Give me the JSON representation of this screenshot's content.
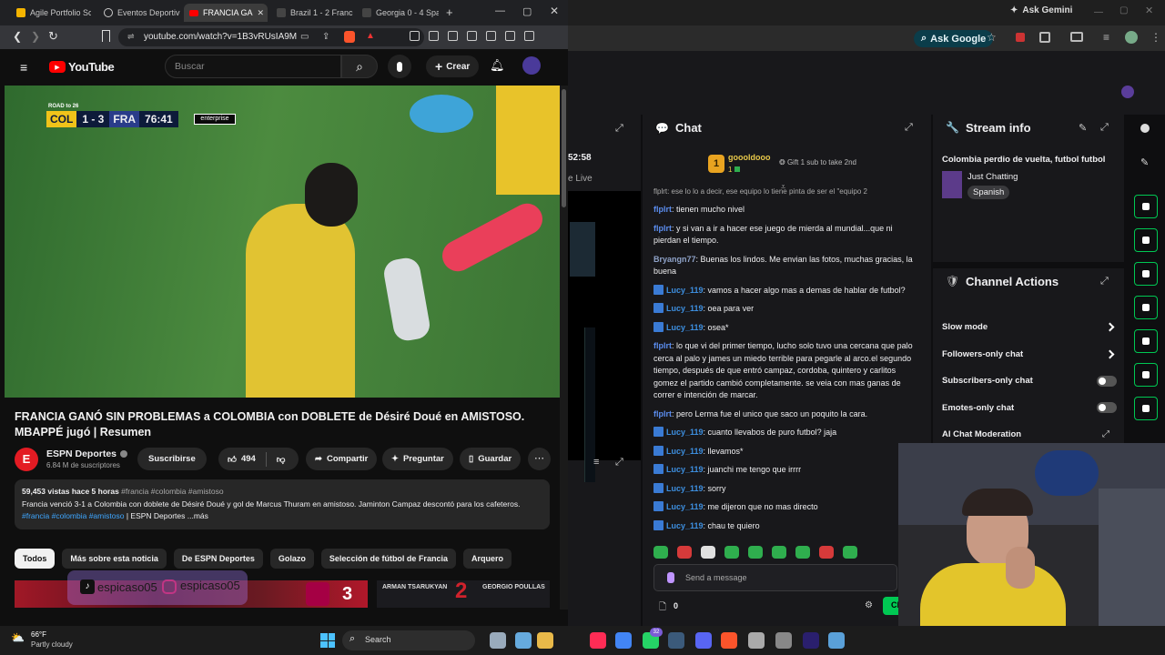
{
  "left_browser": {
    "tabs": [
      {
        "label": "Agile Portfolio Sc"
      },
      {
        "label": "Eventos Deportiv"
      },
      {
        "label": "FRANCIA GA"
      },
      {
        "label": "Brazil 1 - 2 Franc"
      },
      {
        "label": "Georgia 0 - 4 Spa"
      }
    ],
    "url": "youtube.com/watch?v=1B3vRUsIA9M",
    "youtube": {
      "logo_text": "YouTube",
      "search_placeholder": "Buscar",
      "create_label": "Crear",
      "scoreboard": {
        "brand": "ROAD to 26",
        "home": "COL",
        "score": "1 - 3",
        "away": "FRA",
        "time": "76:41",
        "sponsor": "enterprise"
      },
      "video_title": "FRANCIA GANÓ SIN PROBLEMAS a COLOMBIA con DOBLETE de Désiré Doué en AMISTOSO. MBAPPÉ jugó | Resumen",
      "channel_name": "ESPN Deportes",
      "subscribers": "6.84 M de suscriptores",
      "subscribe_label": "Suscribirse",
      "likes": "494",
      "share_label": "Compartir",
      "ask_label": "Preguntar",
      "save_label": "Guardar",
      "views_time": "59,453 vistas  hace 5 horas",
      "hashtags": "#francia #colombia #amistoso",
      "description": "Francia venció 3-1 a Colombia con doblete de Désiré Doué y gol de Marcus Thuram en amistoso. Jaminton Campaz descontó para los cafeteros.",
      "desc_tags": "#francia #colombia #amistoso",
      "desc_tail": "| ESPN Deportes ...más",
      "chips": [
        "Todos",
        "Más sobre esta noticia",
        "De ESPN Deportes",
        "Golazo",
        "Selección de fútbol de Francia",
        "Arquero"
      ],
      "thumb_score": "3",
      "thumb_names": "ARMAN TSARUKYAN",
      "thumb_names2": "GEORGIO POULLAS"
    }
  },
  "overlay": {
    "tiktok_handle": "espicaso05",
    "instagram_handle": "espicaso05"
  },
  "right_browser": {
    "ask_gemini": "Ask Gemini",
    "ask_google": "Ask Google",
    "stream_time": "52:58",
    "live_label": "e Live"
  },
  "chat": {
    "title": "Chat",
    "gifter_name": "goooldooo",
    "gifter_count": "1",
    "gift_text": "Gift 1 sub to take 2nd",
    "truncated_top": "flplrt: ese lo lo a decir, ese equipo lo tiene pinta de ser el \"equipo 2",
    "messages": [
      {
        "user": "flplrt",
        "text": ": tienen mucho nivel",
        "badge": false,
        "color": "#5b8def"
      },
      {
        "user": "flplrt",
        "text": ": y si van a ir a hacer ese juego de mierda al mundial...que ni pierdan el tiempo.",
        "badge": false,
        "color": "#5b8def"
      },
      {
        "user": "Bryangn77",
        "text": ": Buenas los lindos. Me envian las fotos, muchas gracias, la buena",
        "badge": false,
        "color": "#8fa3c9"
      },
      {
        "user": "Lucy_119",
        "text": ": vamos a hacer algo mas a demas de hablar de futbol?",
        "badge": true,
        "color": "#3d8fe0"
      },
      {
        "user": "Lucy_119",
        "text": ": oea para ver",
        "badge": true,
        "color": "#3d8fe0"
      },
      {
        "user": "Lucy_119",
        "text": ": osea*",
        "badge": true,
        "color": "#3d8fe0"
      },
      {
        "user": "flplrt",
        "text": ": lo que vi del primer tiempo, lucho solo tuvo una cercana que palo cerca al palo y james un miedo terrible para pegarle al arco.el segundo tiempo, después de que entró campaz, cordoba, quintero y carlitos gomez el partido cambió completamente. se veia con mas ganas de correr e intención de marcar.",
        "badge": false,
        "color": "#5b8def"
      },
      {
        "user": "flplrt",
        "text": ": pero Lerma fue el unico que saco un poquito la cara.",
        "badge": false,
        "color": "#5b8def"
      },
      {
        "user": "Lucy_119",
        "text": ": cuanto llevabos de puro futbol? jaja",
        "badge": true,
        "color": "#3d8fe0"
      },
      {
        "user": "Lucy_119",
        "text": ": llevamos*",
        "badge": true,
        "color": "#3d8fe0"
      },
      {
        "user": "Lucy_119",
        "text": ": juanchi me tengo que irrrr",
        "badge": true,
        "color": "#3d8fe0"
      },
      {
        "user": "Lucy_119",
        "text": ": sorry",
        "badge": true,
        "color": "#3d8fe0"
      },
      {
        "user": "Lucy_119",
        "text": ": me dijeron que no mas directo",
        "badge": true,
        "color": "#3d8fe0"
      },
      {
        "user": "Lucy_119",
        "text": ": chau te quiero",
        "badge": true,
        "color": "#3d8fe0"
      }
    ],
    "input_placeholder": "Send a message",
    "points": "0",
    "send_label": "Ch"
  },
  "stream_info": {
    "title": "Stream info",
    "stream_title": "Colombia perdio de vuelta, futbol futbol",
    "category": "Just Chatting",
    "language": "Spanish"
  },
  "channel_actions": {
    "title": "Channel Actions",
    "items": [
      {
        "label": "Slow mode",
        "control": "chevron"
      },
      {
        "label": "Followers-only chat",
        "control": "chevron"
      },
      {
        "label": "Subscribers-only chat",
        "control": "toggle"
      },
      {
        "label": "Emotes-only chat",
        "control": "toggle"
      },
      {
        "label": "AI Chat Moderation",
        "control": "external"
      }
    ]
  },
  "taskbar": {
    "temperature": "66°F",
    "weather": "Partly cloudy",
    "search_label": "Search",
    "badge_count": "32"
  },
  "colors": {
    "twitch_purple": "#9147ff",
    "youtube_red": "#ff0000",
    "green": "#00c853"
  }
}
